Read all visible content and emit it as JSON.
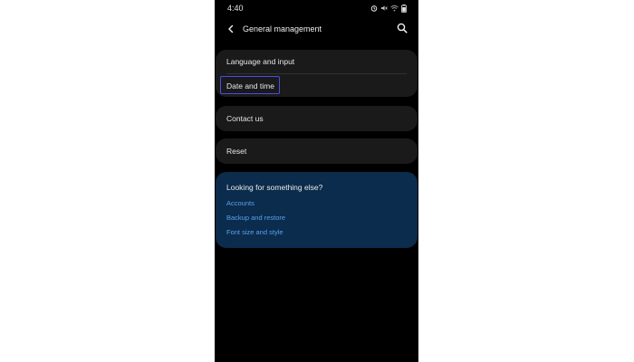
{
  "status_bar": {
    "time": "4:40",
    "icons": [
      "alarm-icon",
      "mute-icon",
      "wifi-icon",
      "battery-icon"
    ]
  },
  "header": {
    "title": "General management",
    "back_icon": "back-arrow-icon",
    "search_icon": "search-icon"
  },
  "menu": {
    "language_input": "Language and input",
    "date_time": "Date and time",
    "contact_us": "Contact us",
    "reset": "Reset"
  },
  "suggestions": {
    "title": "Looking for something else?",
    "links": [
      "Accounts",
      "Backup and restore",
      "Font size and style"
    ]
  },
  "colors": {
    "background": "#000000",
    "card": "#1a1a1a",
    "suggestion_card": "#0b2c4c",
    "link": "#5aa0f0",
    "highlight_border": "#4a4ee0"
  }
}
